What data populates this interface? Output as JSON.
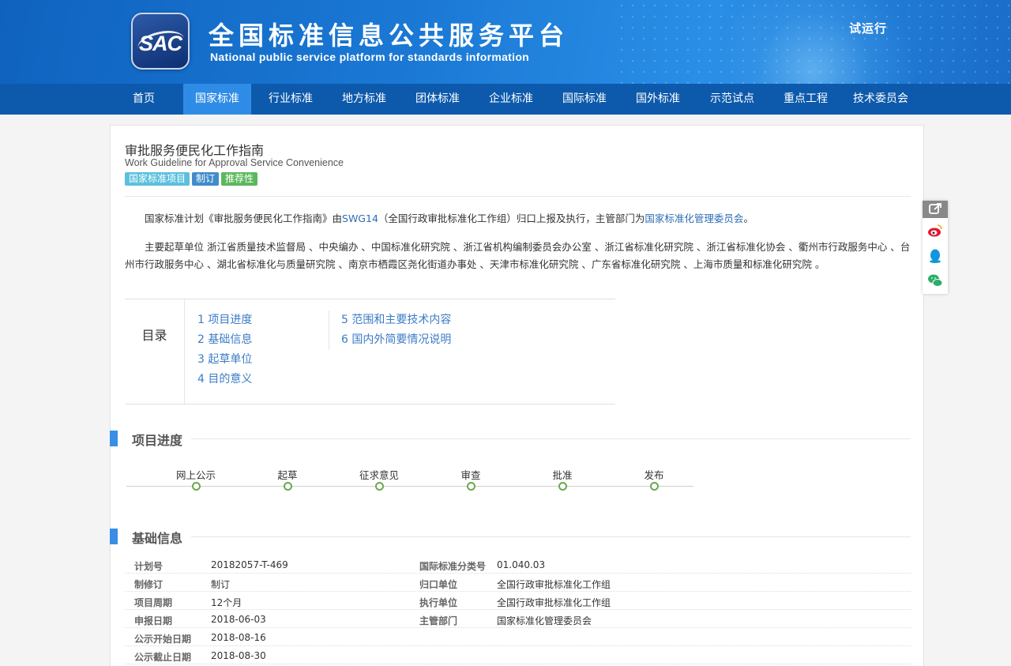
{
  "header": {
    "logo_text": "SAC",
    "title": "全国标准信息公共服务平台",
    "subtitle": "National public service platform  for standards information",
    "trial": "试运行"
  },
  "nav": [
    {
      "label": "首页"
    },
    {
      "label": "国家标准",
      "active": true
    },
    {
      "label": "行业标准"
    },
    {
      "label": "地方标准"
    },
    {
      "label": "团体标准"
    },
    {
      "label": "企业标准"
    },
    {
      "label": "国际标准"
    },
    {
      "label": "国外标准"
    },
    {
      "label": "示范试点"
    },
    {
      "label": "重点工程"
    },
    {
      "label": "技术委员会"
    }
  ],
  "project": {
    "title": "审批服务便民化工作指南",
    "title_en": "Work Guideline for Approval Service Convenience",
    "tags": [
      "国家标准项目",
      "制订",
      "推荐性"
    ],
    "intro": {
      "prefix": "国家标准计划《审批服务便民化工作指南》由",
      "tc_code": "SWG14",
      "middle": "（全国行政审批标准化工作组）归口上报及执行，主管部门为",
      "dept": "国家标准化管理委员会",
      "suffix": "。"
    },
    "drafters": "主要起草单位 浙江省质量技术监督局 、中央编办 、中国标准化研究院 、浙江省机构编制委员会办公室 、浙江省标准化研究院 、浙江省标准化协会 、衢州市行政服务中心 、台州市行政服务中心 、湖北省标准化与质量研究院 、南京市栖霞区尧化街道办事处 、天津市标准化研究院 、广东省标准化研究院 、上海市质量和标准化研究院 。"
  },
  "toc": {
    "label": "目录",
    "items_left": [
      "1  项目进度",
      "2  基础信息",
      "3  起草单位",
      "4  目的意义"
    ],
    "items_right": [
      "5  范围和主要技术内容",
      "6  国内外简要情况说明"
    ]
  },
  "progress": {
    "title": "项目进度",
    "steps": [
      "网上公示",
      "起草",
      "征求意见",
      "审查",
      "批准",
      "发布"
    ]
  },
  "basic_info": {
    "title": "基础信息",
    "left": [
      {
        "key": "计划号",
        "value": "20182057-T-469"
      },
      {
        "key": "制修订",
        "value": "制订"
      },
      {
        "key": "项目周期",
        "value": "12个月"
      },
      {
        "key": "申报日期",
        "value": "2018-06-03"
      },
      {
        "key": "公示开始日期",
        "value": "2018-08-16"
      },
      {
        "key": "公示截止日期",
        "value": "2018-08-30"
      }
    ],
    "right": [
      {
        "key": "国际标准分类号",
        "value": "01.040.03"
      },
      {
        "key": "归口单位",
        "value": "全国行政审批标准化工作组"
      },
      {
        "key": "执行单位",
        "value": "全国行政审批标准化工作组"
      },
      {
        "key": "主管部门",
        "value": "国家标准化管理委员会"
      }
    ]
  },
  "share_icons": [
    "share-icon",
    "weibo-icon",
    "qq-icon",
    "wechat-icon"
  ]
}
